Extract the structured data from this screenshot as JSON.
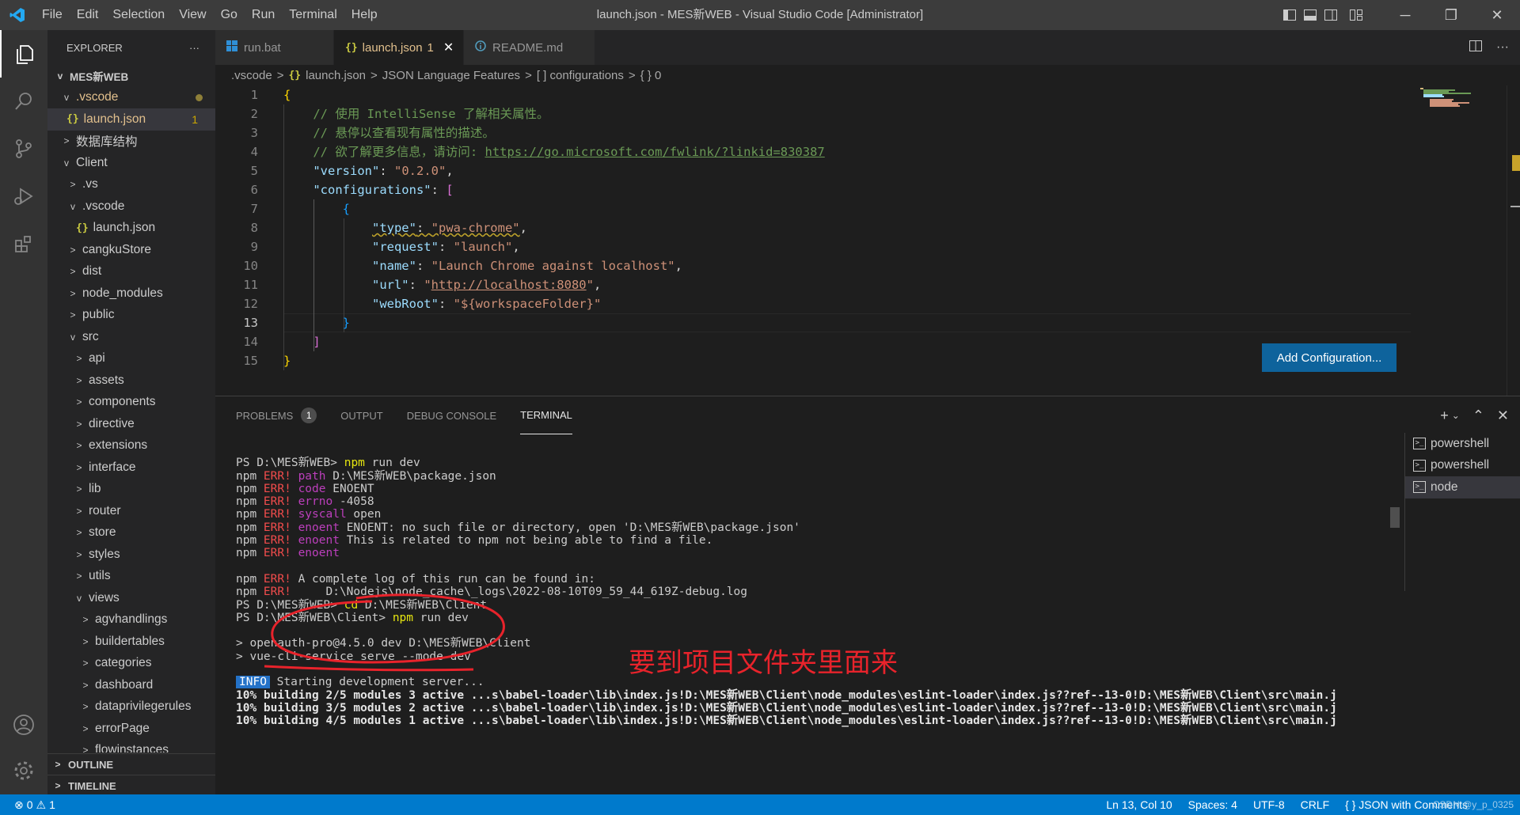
{
  "titlebar": {
    "menu": [
      "File",
      "Edit",
      "Selection",
      "View",
      "Go",
      "Run",
      "Terminal",
      "Help"
    ],
    "title": "launch.json - MES新WEB - Visual Studio Code [Administrator]"
  },
  "explorer": {
    "header": "EXPLORER",
    "more": "···",
    "root": "MES新WEB",
    "vscode_folder": ".vscode",
    "launch_json": "launch.json",
    "launch_badge": "1",
    "items": [
      {
        "label": "数据库结构",
        "indent": 1,
        "chev": ">"
      },
      {
        "label": "Client",
        "indent": 1,
        "chev": "v"
      },
      {
        "label": ".vs",
        "indent": 2,
        "chev": ">"
      },
      {
        "label": ".vscode",
        "indent": 2,
        "chev": "v"
      },
      {
        "label": "launch.json",
        "indent": 3,
        "chev": "",
        "json": true
      },
      {
        "label": "cangkuStore",
        "indent": 2,
        "chev": ">"
      },
      {
        "label": "dist",
        "indent": 2,
        "chev": ">"
      },
      {
        "label": "node_modules",
        "indent": 2,
        "chev": ">"
      },
      {
        "label": "public",
        "indent": 2,
        "chev": ">"
      },
      {
        "label": "src",
        "indent": 2,
        "chev": "v"
      },
      {
        "label": "api",
        "indent": 3,
        "chev": ">"
      },
      {
        "label": "assets",
        "indent": 3,
        "chev": ">"
      },
      {
        "label": "components",
        "indent": 3,
        "chev": ">"
      },
      {
        "label": "directive",
        "indent": 3,
        "chev": ">"
      },
      {
        "label": "extensions",
        "indent": 3,
        "chev": ">"
      },
      {
        "label": "interface",
        "indent": 3,
        "chev": ">"
      },
      {
        "label": "lib",
        "indent": 3,
        "chev": ">"
      },
      {
        "label": "router",
        "indent": 3,
        "chev": ">"
      },
      {
        "label": "store",
        "indent": 3,
        "chev": ">"
      },
      {
        "label": "styles",
        "indent": 3,
        "chev": ">"
      },
      {
        "label": "utils",
        "indent": 3,
        "chev": ">"
      },
      {
        "label": "views",
        "indent": 3,
        "chev": "v"
      },
      {
        "label": "agvhandlings",
        "indent": 4,
        "chev": ">"
      },
      {
        "label": "buildertables",
        "indent": 4,
        "chev": ">"
      },
      {
        "label": "categories",
        "indent": 4,
        "chev": ">"
      },
      {
        "label": "dashboard",
        "indent": 4,
        "chev": ">"
      },
      {
        "label": "dataprivilegerules",
        "indent": 4,
        "chev": ">"
      },
      {
        "label": "errorPage",
        "indent": 4,
        "chev": ">"
      },
      {
        "label": "flowinstances",
        "indent": 4,
        "chev": ">"
      }
    ],
    "outline": "OUTLINE",
    "timeline": "TIMELINE"
  },
  "tabs": [
    {
      "label": "run.bat",
      "icon": "windows-icon"
    },
    {
      "label": "launch.json",
      "badge": "1",
      "icon": "json-icon",
      "active": true
    },
    {
      "label": "README.md",
      "icon": "info-icon"
    }
  ],
  "breadcrumb": [
    ".vscode",
    "launch.json",
    "JSON Language Features",
    "[ ] configurations",
    "{ } 0"
  ],
  "editor": {
    "line_numbers": [
      "1",
      "2",
      "3",
      "4",
      "5",
      "6",
      "7",
      "8",
      "9",
      "10",
      "11",
      "12",
      "13",
      "14",
      "15"
    ],
    "current_line": "13",
    "comment1": "// 使用 IntelliSense 了解相关属性。",
    "comment2": "// 悬停以查看现有属性的描述。",
    "comment3_prefix": "// 欲了解更多信息，请访问: ",
    "comment3_link": "https://go.microsoft.com/fwlink/?linkid=830387",
    "version_key": "\"version\"",
    "version_val": "\"0.2.0\"",
    "configurations_key": "\"configurations\"",
    "type_key": "\"type\"",
    "type_val": "\"pwa-chrome\"",
    "request_key": "\"request\"",
    "request_val": "\"launch\"",
    "name_key": "\"name\"",
    "name_val": "\"Launch Chrome against localhost\"",
    "url_key": "\"url\"",
    "url_val": "http://localhost:8080",
    "webroot_key": "\"webRoot\"",
    "webroot_val": "\"${workspaceFolder}\"",
    "add_config": "Add Configuration..."
  },
  "panel": {
    "tabs": [
      "PROBLEMS",
      "OUTPUT",
      "DEBUG CONSOLE",
      "TERMINAL"
    ],
    "problems_count": "1",
    "terminals": [
      "powershell",
      "powershell",
      "node"
    ]
  },
  "terminal": {
    "prompt1": "PS D:\\MES新WEB> ",
    "cmd1": "npm",
    "cmd1_rest": " run dev",
    "errors": [
      {
        "label": "path",
        "rest": " D:\\MES新WEB\\package.json"
      },
      {
        "label": "code",
        "rest": " ENOENT"
      },
      {
        "label": "errno",
        "rest": " -4058"
      },
      {
        "label": "syscall",
        "rest": " open"
      },
      {
        "label": "enoent",
        "rest": " ENOENT: no such file or directory, open 'D:\\MES新WEB\\package.json'"
      },
      {
        "label": "enoent",
        "rest": " This is related to npm not being able to find a file."
      },
      {
        "label": "enoent",
        "rest": ""
      }
    ],
    "npm": "npm ",
    "err": "ERR!",
    "log_line1": " A complete log of this run can be found in:",
    "log_line2": "     D:\\Nodejs\\node_cache\\_logs\\2022-08-10T09_59_44_619Z-debug.log",
    "prompt2": "PS D:\\MES新WEB> ",
    "cmd2": "cd",
    "cmd2_rest": " D:\\MES新WEB\\Client",
    "prompt3": "PS D:\\MES新WEB\\Client> ",
    "cmd3": "npm",
    "cmd3_rest": " run dev",
    "out1": "> openauth-pro@4.5.0 dev D:\\MES新WEB\\Client",
    "out2": "> vue-cli-service serve --mode dev",
    "info": "INFO",
    "info_rest": " Starting development server...",
    "build1": "10% building 2/5 modules 3 active ...s\\babel-loader\\lib\\index.js!D:\\MES新WEB\\Client\\node_modules\\eslint-loader\\index.js??ref--13-0!D:\\MES新WEB\\Client\\src\\main.j",
    "build2": "10% building 3/5 modules 2 active ...s\\babel-loader\\lib\\index.js!D:\\MES新WEB\\Client\\node_modules\\eslint-loader\\index.js??ref--13-0!D:\\MES新WEB\\Client\\src\\main.j",
    "build3": "10% building 4/5 modules 1 active ...s\\babel-loader\\lib\\index.js!D:\\MES新WEB\\Client\\node_modules\\eslint-loader\\index.js??ref--13-0!D:\\MES新WEB\\Client\\src\\main.j"
  },
  "annotation": "要到项目文件夹里面来",
  "statusbar": {
    "errors": "0",
    "warnings": "1",
    "position": "Ln 13, Col 10",
    "spaces": "Spaces: 4",
    "encoding": "UTF-8",
    "eol": "CRLF",
    "language": "{ } JSON with Comments",
    "watermark": "CSDN @y_p_0325"
  },
  "colors": {
    "accent": "#007acc",
    "button": "#0e639c",
    "annotation": "#e8232b"
  }
}
